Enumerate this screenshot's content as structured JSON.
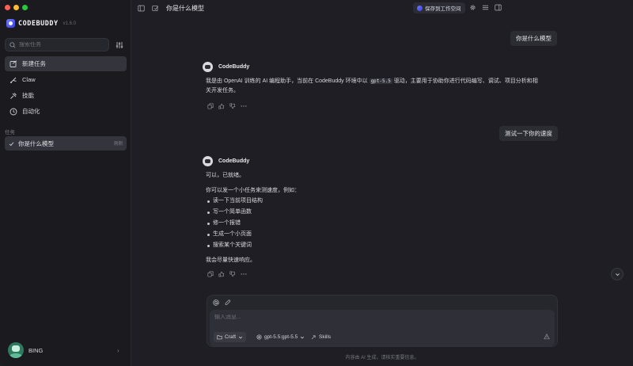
{
  "app": {
    "brand_name": "CODEBUDDY",
    "version": "v1.6.0"
  },
  "sidebar": {
    "search_placeholder": "搜索任务",
    "nav": [
      {
        "label": "新建任务",
        "icon": "new-task-icon"
      },
      {
        "label": "Claw",
        "icon": "claw-icon"
      },
      {
        "label": "技能",
        "icon": "skills-icon"
      },
      {
        "label": "自动化",
        "icon": "clock-icon"
      }
    ],
    "section_title": "任务",
    "tasks": [
      {
        "title": "你是什么模型",
        "time": "刚刚"
      }
    ],
    "user_name": "BING"
  },
  "topbar": {
    "title": "你是什么模型",
    "save_label": "保存到工作空间"
  },
  "conversation": {
    "bot_name": "CodeBuddy",
    "user_msg_1": "你是什么模型",
    "reply_1_pre": "我是由 OpenAI 训练的 AI 编程助手，当前在 CodeBuddy 环境中以",
    "reply_1_code": "gpt-5.5",
    "reply_1_post": "驱动，主要用于协助你进行代码编写、调试、项目分析和相",
    "reply_1_line2": "关开发任务。",
    "user_msg_2": "测试一下你的速度",
    "reply_2_line1": "可以，已就绪。",
    "reply_2_line2": "你可以发一个小任务来测速度，例如：",
    "reply_2_bullets": [
      "读一下当前项目结构",
      "写一个简单函数",
      "修一个报错",
      "生成一个小页面",
      "搜索某个关键词"
    ],
    "reply_2_footer": "我会尽量快速响应。"
  },
  "composer": {
    "placeholder": "输入消息...",
    "mode_label": "Craft",
    "model_label": "gpt-5.5:gpt-5.5",
    "skills_label": "Skills",
    "disclaimer": "内容由 AI 生成，请核实重要信息。"
  }
}
